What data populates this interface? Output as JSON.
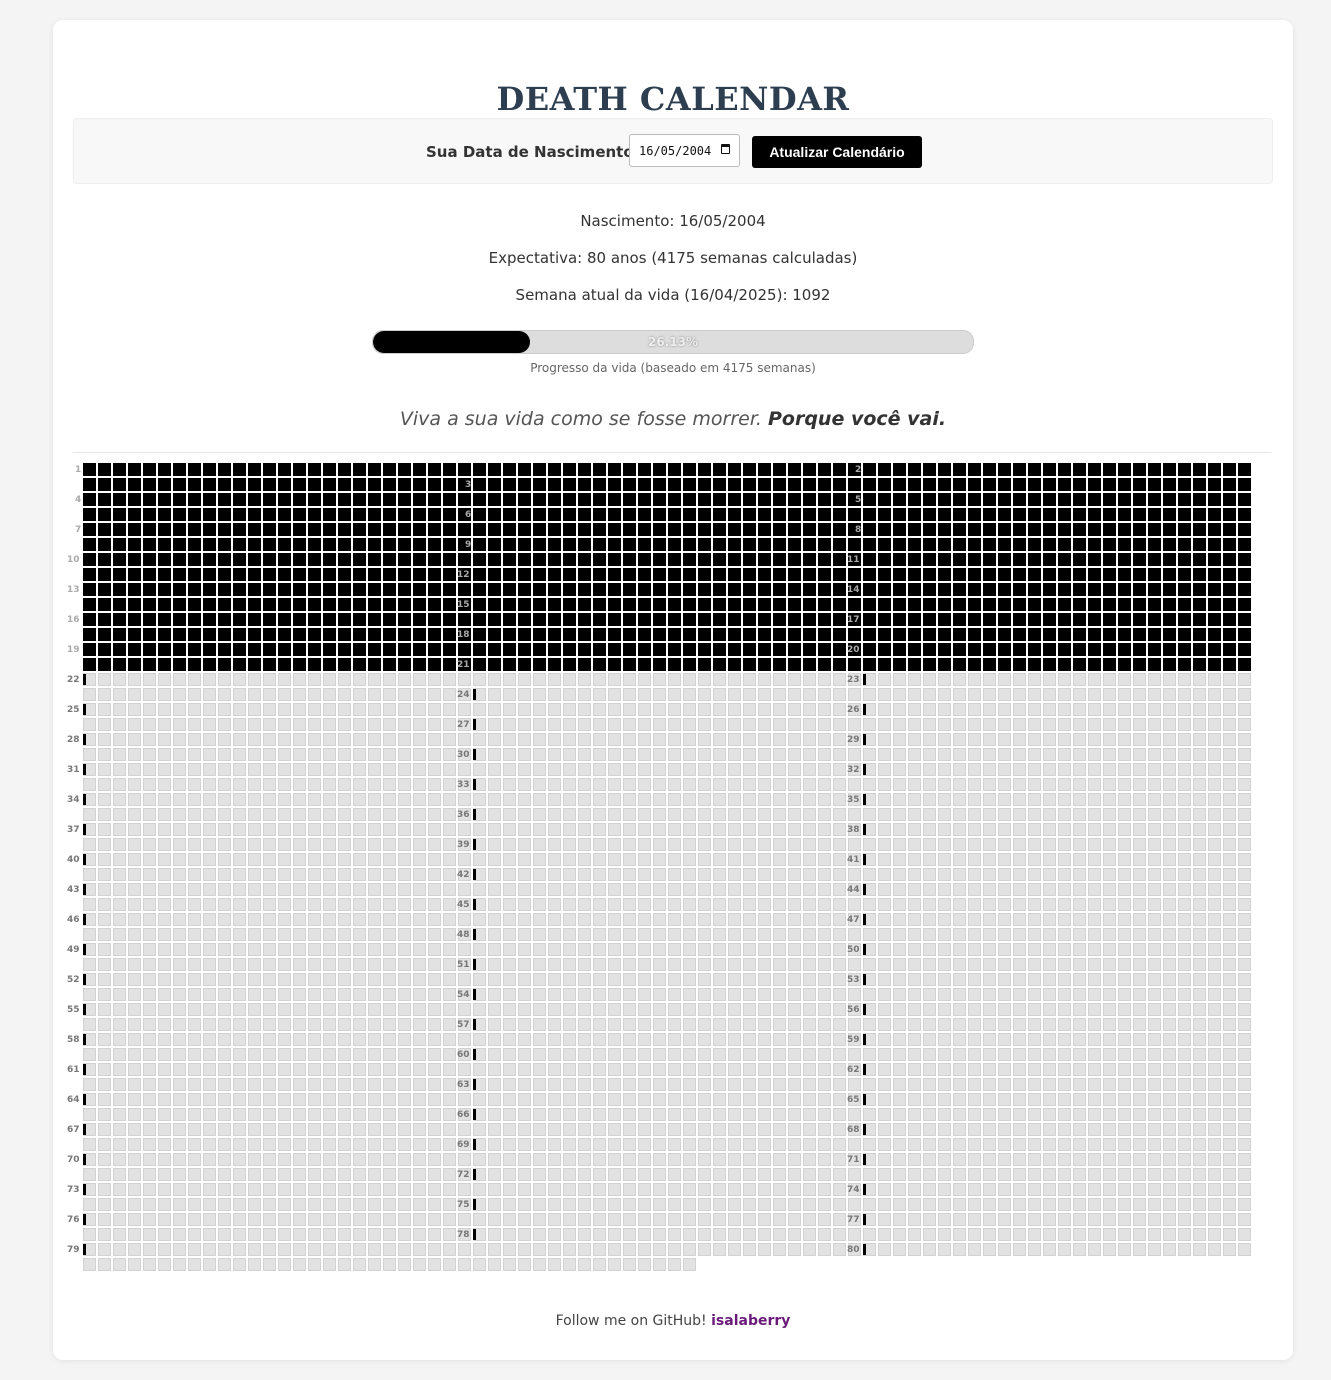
{
  "header": {
    "title": "DEATH CALENDAR"
  },
  "form": {
    "label": "Sua Data de Nascimento:",
    "date_value": "16/05/2004",
    "update_button": "Atualizar Calendário"
  },
  "info": {
    "birth": "Nascimento: 16/05/2004",
    "expectancy": "Expectativa: 80 anos (4175 semanas calculadas)",
    "current_week": "Semana atual da vida (16/04/2025): 1092"
  },
  "progress": {
    "percent_text": "26.13%",
    "fraction": 0.2613,
    "caption": "Progresso da vida (baseado em 4175 semanas)"
  },
  "quote": {
    "text": "Viva a sua vida como se fosse morrer.",
    "bold": "Porque você vai."
  },
  "calendar": {
    "total_weeks": 4175,
    "lived_weeks": 1092,
    "year_labels": [
      "1",
      "2",
      "3",
      "4",
      "5",
      "6",
      "7",
      "8",
      "9",
      "10",
      "11",
      "12",
      "13",
      "14",
      "15",
      "16",
      "17",
      "18",
      "19",
      "20",
      "21",
      "22",
      "23",
      "24",
      "25",
      "26",
      "27",
      "28",
      "29",
      "30",
      "31",
      "32",
      "33",
      "34",
      "35",
      "36",
      "37",
      "38",
      "39",
      "40",
      "41",
      "42",
      "43",
      "44",
      "45",
      "46",
      "47",
      "48",
      "49",
      "50",
      "51",
      "52",
      "53",
      "54",
      "55",
      "56",
      "57",
      "58",
      "59",
      "60",
      "61",
      "62",
      "63",
      "64",
      "65",
      "66",
      "67",
      "68",
      "69",
      "70",
      "71",
      "72",
      "73",
      "74",
      "75",
      "76",
      "77",
      "78",
      "79",
      "80"
    ]
  },
  "colors": {
    "lived": "#000000",
    "future": "#e2e2e2",
    "accent_link": "#6a1b7a"
  },
  "footer": {
    "text": "Follow me on GitHub!",
    "link": "isalaberry"
  }
}
